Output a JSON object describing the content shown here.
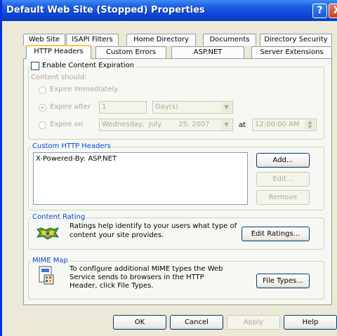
{
  "window": {
    "title": "Default Web Site (Stopped) Properties",
    "help_glyph": "?",
    "close_glyph": "X"
  },
  "tabs_row1": [
    "Web Site",
    "ISAPI Filters",
    "Home Directory",
    "Documents",
    "Directory Security"
  ],
  "tabs_row2": [
    "HTTP Headers",
    "Custom Errors",
    "ASP.NET",
    "Server Extensions"
  ],
  "active_tab": "HTTP Headers",
  "content_expiration": {
    "checkbox_label": "Enable Content Expiration",
    "checked": false,
    "content_should": "Content should:",
    "expire_immediately": "Expire Immediately",
    "expire_after": "Expire after",
    "expire_after_value": "1",
    "expire_after_unit": "Day(s)",
    "expire_on": "Expire on",
    "date_weekday": "Wednesday,",
    "date_month": "July",
    "date_day_year": "25, 2007",
    "at": "at",
    "time": "12:00:00 AM"
  },
  "custom_headers": {
    "legend": "Custom HTTP Headers",
    "items": [
      "X-Powered-By: ASP.NET"
    ],
    "add": "Add...",
    "edit": "Edit...",
    "remove": "Remove"
  },
  "content_rating": {
    "legend": "Content Rating",
    "text_line1": "Ratings help identify to your users what type of",
    "text_line2": "content your site provides.",
    "button": "Edit Ratings..."
  },
  "mime_map": {
    "legend": "MIME Map",
    "text_line1": "To configure additional MIME types the Web",
    "text_line2": "Service sends to browsers in the HTTP",
    "text_line3": "Header, click File Types.",
    "button": "File Types..."
  },
  "footer": {
    "ok": "OK",
    "cancel": "Cancel",
    "apply": "Apply",
    "help": "Help"
  },
  "colors": {
    "titlebar": "#0A46D8",
    "dialog_bg": "#ECE9D8",
    "group_label": "#0046D5",
    "tab_highlight": "#FFC83C"
  },
  "icons": {
    "rating": "rating-award-icon",
    "mime": "mime-file-types-icon"
  }
}
